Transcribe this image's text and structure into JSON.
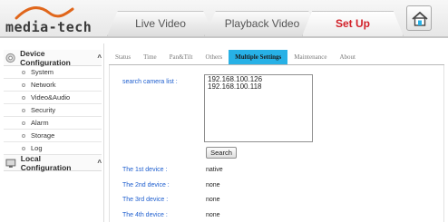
{
  "brand": {
    "logo_text": "media-tech"
  },
  "nav": {
    "live": "Live Video",
    "playback": "Playback Video",
    "setup": "Set Up"
  },
  "sidebar": {
    "device_config": "Device Configuration",
    "items": [
      "System",
      "Network",
      "Video&Audio",
      "Security",
      "Alarm",
      "Storage",
      "Log"
    ],
    "local_config": "Local Configuration",
    "caret": "^"
  },
  "tabs": [
    "Status",
    "Time",
    "Pan&Tilt",
    "Others",
    "Multiple Settings",
    "Maintenance",
    "About"
  ],
  "active_tab": "Multiple Settings",
  "form": {
    "search_label": "search camera list :",
    "camera_list": [
      "192.168.100.126",
      "192.168.100.118"
    ],
    "search_button": "Search",
    "devices": [
      {
        "label": "The 1st device :",
        "value": "native"
      },
      {
        "label": "The 2nd device :",
        "value": "none"
      },
      {
        "label": "The 3rd device :",
        "value": "none"
      },
      {
        "label": "The 4th device :",
        "value": "none"
      }
    ]
  },
  "colors": {
    "accent": "#27b1e6",
    "setup_red": "#d2222a",
    "label_blue": "#1f5fcf"
  }
}
